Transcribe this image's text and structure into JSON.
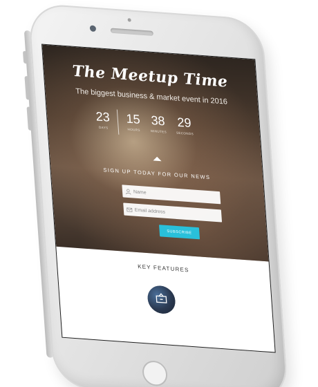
{
  "hero": {
    "title": "The Meetup Time",
    "subtitle": "The biggest business & market event in 2016"
  },
  "countdown": {
    "days": {
      "value": "23",
      "label": "DAYS"
    },
    "hours": {
      "value": "15",
      "label": "HOURS"
    },
    "minutes": {
      "value": "38",
      "label": "MINUTES"
    },
    "seconds": {
      "value": "29",
      "label": "SECONDS"
    }
  },
  "signup": {
    "title": "SIGN UP TODAY FOR OUR NEWS",
    "name_placeholder": "Name",
    "email_placeholder": "Email address",
    "subscribe_label": "SUBSCRIBE"
  },
  "features": {
    "title": "KEY FEATURES",
    "badge_icon": "ticket-icon"
  },
  "colors": {
    "accent": "#29c0da",
    "phone_body": "#e6e6e6"
  }
}
